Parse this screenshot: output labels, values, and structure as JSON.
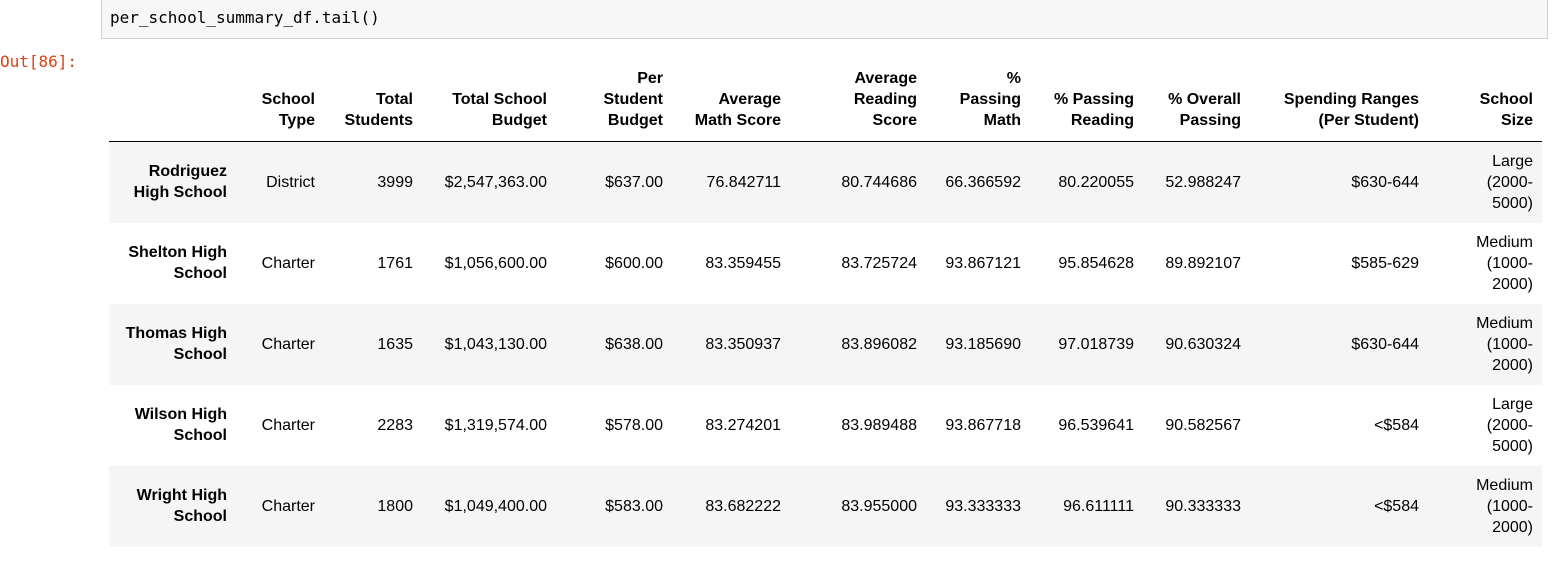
{
  "cell": {
    "code": "per_school_summary_df.tail()",
    "out_prompt": "Out[86]:"
  },
  "table": {
    "headers": [
      "",
      "School Type",
      "Total Students",
      "Total School Budget",
      "Per Student Budget",
      "Average Math Score",
      "Average Reading Score",
      "% Passing Math",
      "% Passing Reading",
      "% Overall Passing",
      "Spending Ranges (Per Student)",
      "School Size"
    ],
    "rows": [
      {
        "index": "Rodriguez High School",
        "cells": [
          "District",
          "3999",
          "$2,547,363.00",
          "$637.00",
          "76.842711",
          "80.744686",
          "66.366592",
          "80.220055",
          "52.988247",
          "$630-644",
          "Large (2000-5000)"
        ]
      },
      {
        "index": "Shelton High School",
        "cells": [
          "Charter",
          "1761",
          "$1,056,600.00",
          "$600.00",
          "83.359455",
          "83.725724",
          "93.867121",
          "95.854628",
          "89.892107",
          "$585-629",
          "Medium (1000-2000)"
        ]
      },
      {
        "index": "Thomas High School",
        "cells": [
          "Charter",
          "1635",
          "$1,043,130.00",
          "$638.00",
          "83.350937",
          "83.896082",
          "93.185690",
          "97.018739",
          "90.630324",
          "$630-644",
          "Medium (1000-2000)"
        ]
      },
      {
        "index": "Wilson High School",
        "cells": [
          "Charter",
          "2283",
          "$1,319,574.00",
          "$578.00",
          "83.274201",
          "83.989488",
          "93.867718",
          "96.539641",
          "90.582567",
          "<$584",
          "Large (2000-5000)"
        ]
      },
      {
        "index": "Wright High School",
        "cells": [
          "Charter",
          "1800",
          "$1,049,400.00",
          "$583.00",
          "83.682222",
          "83.955000",
          "93.333333",
          "96.611111",
          "90.333333",
          "<$584",
          "Medium (1000-2000)"
        ]
      }
    ]
  }
}
